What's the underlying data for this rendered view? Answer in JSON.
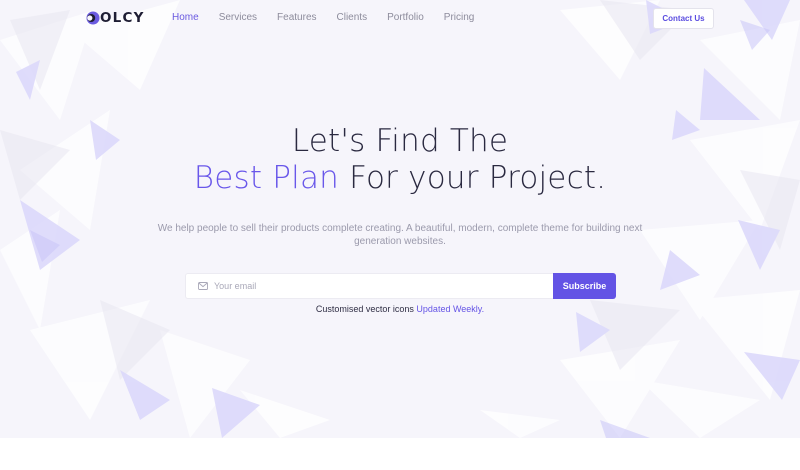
{
  "brand": {
    "name": "OLCY",
    "logo_icon": "logo-mark-icon"
  },
  "nav": {
    "items": [
      {
        "label": "Home",
        "active": true
      },
      {
        "label": "Services",
        "active": false
      },
      {
        "label": "Features",
        "active": false
      },
      {
        "label": "Clients",
        "active": false
      },
      {
        "label": "Portfolio",
        "active": false
      },
      {
        "label": "Pricing",
        "active": false
      }
    ],
    "contact_label": "Contact Us"
  },
  "hero": {
    "line1": "Let's Find The",
    "line2_accent": "Best Plan",
    "line2_rest": " For your Project.",
    "subtext": "We help people to sell their products complete creating. A beautiful, modern, complete theme for building next generation websites."
  },
  "subscribe": {
    "placeholder": "Your email",
    "button_label": "Subscribe",
    "mail_icon": "mail-icon"
  },
  "note": {
    "text": "Customised vector icons ",
    "link": "Updated Weekly."
  },
  "colors": {
    "accent": "#6957ea",
    "button": "#6353e5",
    "hero_bg": "#f6f5fb",
    "text_dark": "#2a2940"
  }
}
